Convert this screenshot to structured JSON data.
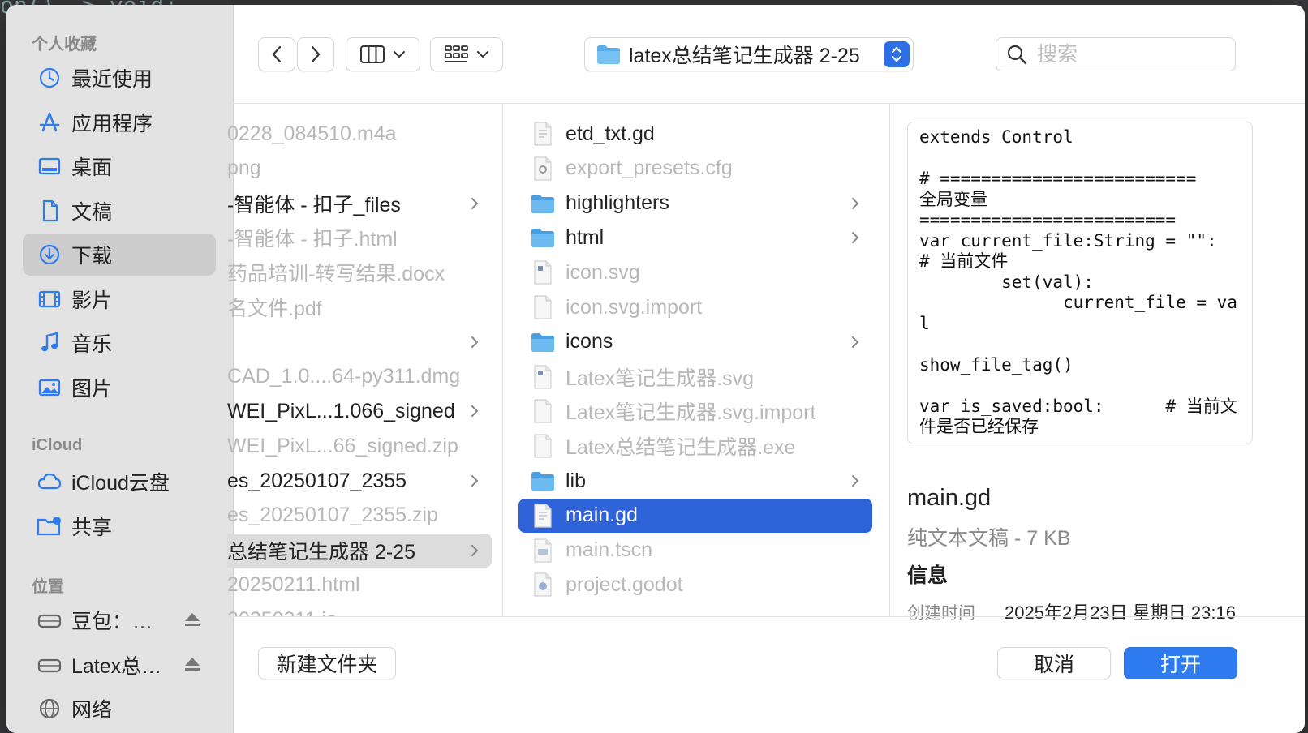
{
  "sidebar": {
    "favorites_header": "个人收藏",
    "favorites": [
      {
        "label": "最近使用",
        "icon": "clock-icon"
      },
      {
        "label": "应用程序",
        "icon": "apps-icon"
      },
      {
        "label": "桌面",
        "icon": "desktop-icon"
      },
      {
        "label": "文稿",
        "icon": "document-icon"
      },
      {
        "label": "下载",
        "icon": "download-icon",
        "selected": true
      },
      {
        "label": "影片",
        "icon": "film-icon"
      },
      {
        "label": "音乐",
        "icon": "music-icon"
      },
      {
        "label": "图片",
        "icon": "photo-icon"
      }
    ],
    "icloud_header": "iCloud",
    "icloud": [
      {
        "label": "iCloud云盘",
        "icon": "cloud-icon"
      },
      {
        "label": "共享",
        "icon": "shared-folder-icon"
      }
    ],
    "locations_header": "位置",
    "locations": [
      {
        "label": "豆包：…",
        "icon": "drive-icon"
      },
      {
        "label": "Latex总…",
        "icon": "drive-icon"
      },
      {
        "label": "网络",
        "icon": "network-icon"
      }
    ]
  },
  "toolbar": {
    "path_title": "latex总结笔记生成器 2-25",
    "search_placeholder": "搜索"
  },
  "column1": [
    {
      "name": "0228_084510.m4a",
      "dim": true
    },
    {
      "name": "png",
      "dim": true
    },
    {
      "name": "-智能体 - 扣子_files",
      "dim": false,
      "folder": true
    },
    {
      "name": "-智能体 - 扣子.html",
      "dim": true
    },
    {
      "name": "药品培训-转写结果.docx",
      "dim": true
    },
    {
      "name": "名文件.pdf",
      "dim": true
    },
    {
      "name": "",
      "dim": false,
      "folder": true
    },
    {
      "name": "CAD_1.0....64-py311.dmg",
      "dim": true
    },
    {
      "name": "WEI_PixL...1.066_signed",
      "dim": false,
      "folder": true
    },
    {
      "name": "WEI_PixL...66_signed.zip",
      "dim": true
    },
    {
      "name": "es_20250107_2355",
      "dim": false,
      "folder": true
    },
    {
      "name": "es_20250107_2355.zip",
      "dim": true
    },
    {
      "name": "总结笔记生成器 2-25",
      "dim": false,
      "folder": true,
      "selected": true
    },
    {
      "name": "20250211.html",
      "dim": true
    },
    {
      "name": "20250211.io",
      "dim": true
    }
  ],
  "column2": [
    {
      "name": "etd_txt.gd",
      "dim": false,
      "icon": "gd-file-icon"
    },
    {
      "name": "export_presets.cfg",
      "dim": true,
      "icon": "cfg-file-icon"
    },
    {
      "name": "highlighters",
      "dim": false,
      "folder": true,
      "icon": "folder-icon"
    },
    {
      "name": "html",
      "dim": false,
      "folder": true,
      "icon": "folder-icon"
    },
    {
      "name": "icon.svg",
      "dim": true,
      "icon": "svg-file-icon"
    },
    {
      "name": "icon.svg.import",
      "dim": true,
      "icon": "blank-file-icon"
    },
    {
      "name": "icons",
      "dim": false,
      "folder": true,
      "icon": "folder-icon"
    },
    {
      "name": "Latex笔记生成器.svg",
      "dim": true,
      "icon": "svg-file-icon"
    },
    {
      "name": "Latex笔记生成器.svg.import",
      "dim": true,
      "icon": "blank-file-icon"
    },
    {
      "name": "Latex总结笔记生成器.exe",
      "dim": true,
      "icon": "blank-file-icon"
    },
    {
      "name": "lib",
      "dim": false,
      "folder": true,
      "icon": "folder-icon"
    },
    {
      "name": "main.gd",
      "dim": false,
      "selected": true,
      "icon": "gd-file-icon"
    },
    {
      "name": "main.tscn",
      "dim": true,
      "icon": "tscn-file-icon"
    },
    {
      "name": "project.godot",
      "dim": true,
      "icon": "godot-file-icon"
    }
  ],
  "preview": {
    "code": "extends Control\n\n# =========================\n全局变量\n=========================\nvar current_file:String = \"\":\n# 当前文件\n        set(val):\n              current_file = val\n\nshow_file_tag()\n\nvar is_saved:bool:      # 当前文件是否已经保存",
    "file_name": "main.gd",
    "file_kind": "纯文本文稿 - 7 KB",
    "info_header": "信息",
    "created_label": "创建时间",
    "created_value": "2025年2月23日 星期日 23:16"
  },
  "buttons": {
    "new_folder": "新建文件夹",
    "cancel": "取消",
    "open": "打开"
  },
  "colors": {
    "accent": "#2f63d9",
    "primary_button": "#2f7cf0",
    "folder": "#5aaeea",
    "sidebar_icon": "#2f7cf0"
  }
}
